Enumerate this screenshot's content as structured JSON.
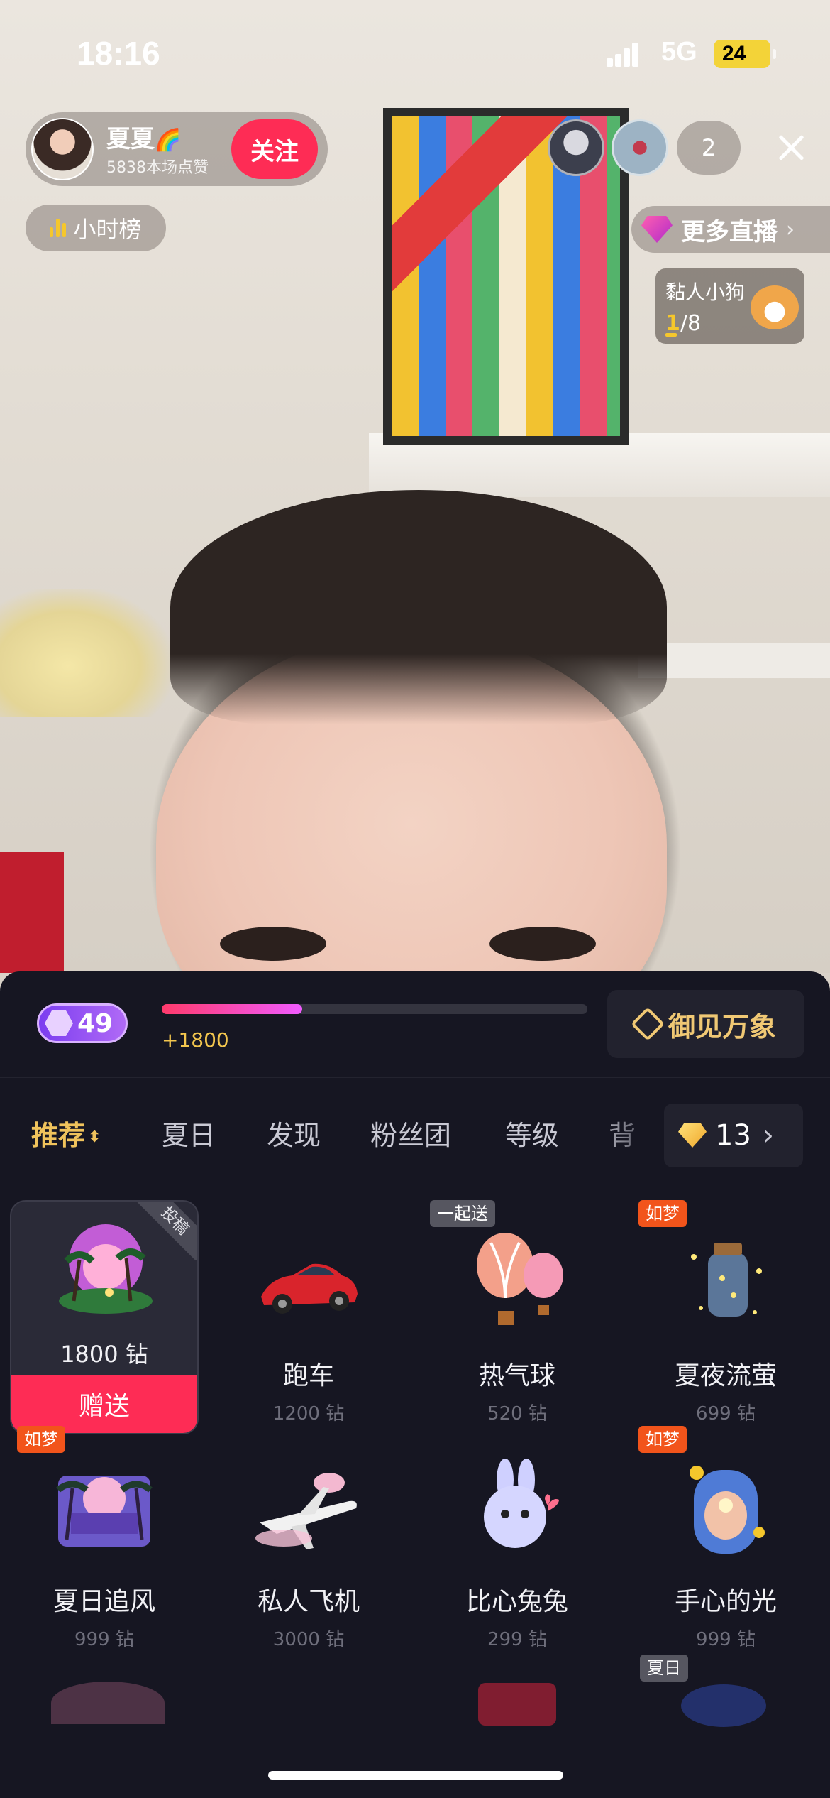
{
  "status_bar": {
    "time": "18:16",
    "network": "5G",
    "battery": "24"
  },
  "host": {
    "name": "夏夏",
    "name_emoji": "🌈",
    "likes_text": "5838本场点赞",
    "follow_label": "关注"
  },
  "hourly_rank_label": "小时榜",
  "viewer_count": "2",
  "more_live_label": "更多直播",
  "task": {
    "title": "黏人小狗",
    "current": "1",
    "total": "/8"
  },
  "panel": {
    "level": "49",
    "exp_gain": "+1800",
    "exp_progress": 0.33,
    "promo_label": "御见万象",
    "tabs": [
      "推荐",
      "夏日",
      "发现",
      "粉丝团",
      "等级",
      "背"
    ],
    "active_tab_index": 0,
    "balance": "13",
    "send_label": "赠送",
    "gifts": [
      {
        "name": "",
        "price": "1800 钻",
        "corner_tag": "投稿",
        "selected": true,
        "icon": "summer-island-icon"
      },
      {
        "name": "跑车",
        "price": "1200 钻",
        "icon": "sports-car-icon"
      },
      {
        "name": "热气球",
        "price": "520 钻",
        "tag": "一起送",
        "tag_color": "gray",
        "icon": "hot-air-balloon-icon"
      },
      {
        "name": "夏夜流萤",
        "price": "699 钻",
        "tag": "如梦",
        "tag_color": "orange",
        "icon": "firefly-jar-icon"
      },
      {
        "name": "夏日追风",
        "price": "999 钻",
        "tag": "如梦",
        "tag_color": "orange",
        "icon": "beach-sunset-icon"
      },
      {
        "name": "私人飞机",
        "price": "3000 钻",
        "icon": "private-jet-icon"
      },
      {
        "name": "比心兔兔",
        "price": "299 钻",
        "icon": "heart-bunny-icon"
      },
      {
        "name": "手心的光",
        "price": "999 钻",
        "tag": "如梦",
        "tag_color": "orange",
        "icon": "glowing-hands-icon"
      }
    ],
    "next_row_tag": "夏日"
  },
  "colors": {
    "accent_red": "#fe2c55",
    "gold": "#f0c35c",
    "panel_bg": "#161622",
    "tag_orange": "#f2541b"
  }
}
